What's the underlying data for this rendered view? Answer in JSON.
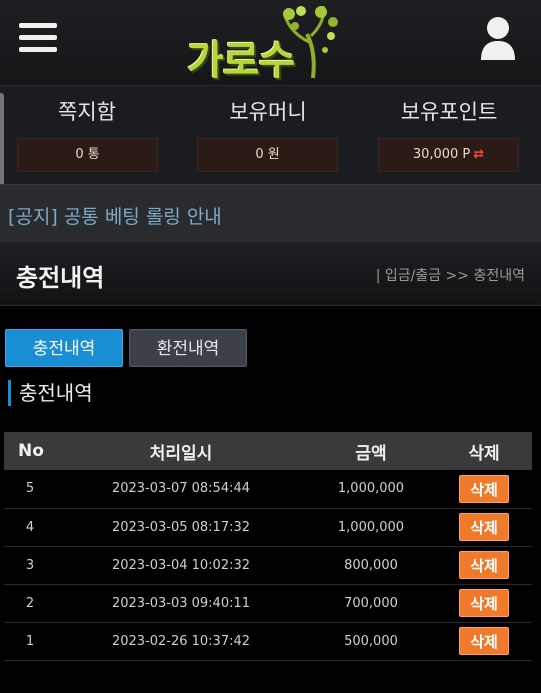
{
  "header": {
    "logo_text": "가로수"
  },
  "stats": [
    {
      "title": "쪽지함",
      "value": "0 통",
      "swap": ""
    },
    {
      "title": "보유머니",
      "value": "0 원",
      "swap": ""
    },
    {
      "title": "보유포인트",
      "value": "30,000 P",
      "swap": "⇄"
    }
  ],
  "notice": {
    "text": "[공지] 공통 베팅 롤링 안내"
  },
  "section": {
    "title": "충전내역",
    "breadcrumb": "| 입금/출금 >> 충전내역"
  },
  "tabs": [
    {
      "label": "충전내역",
      "active": true
    },
    {
      "label": "환전내역",
      "active": false
    }
  ],
  "subhead": "충전내역",
  "table": {
    "headers": [
      "No",
      "처리일시",
      "금액",
      "삭제"
    ],
    "rows": [
      {
        "no": "5",
        "date": "2023-03-07 08:54:44",
        "amount": "1,000,000",
        "action": "삭제"
      },
      {
        "no": "4",
        "date": "2023-03-05 08:17:32",
        "amount": "1,000,000",
        "action": "삭제"
      },
      {
        "no": "3",
        "date": "2023-03-04 10:02:32",
        "amount": "800,000",
        "action": "삭제"
      },
      {
        "no": "2",
        "date": "2023-03-03 09:40:11",
        "amount": "700,000",
        "action": "삭제"
      },
      {
        "no": "1",
        "date": "2023-02-26 10:37:42",
        "amount": "500,000",
        "action": "삭제"
      }
    ]
  },
  "colors": {
    "accent": "#1a8ed3",
    "delete": "#f07a2c",
    "notice": "#7ca9c8",
    "logo": "#b7d43a"
  },
  "icons": {
    "menu": "hamburger-icon",
    "user": "user-icon",
    "swap": "swap-arrows-icon",
    "logo": "tree-logo-icon"
  }
}
